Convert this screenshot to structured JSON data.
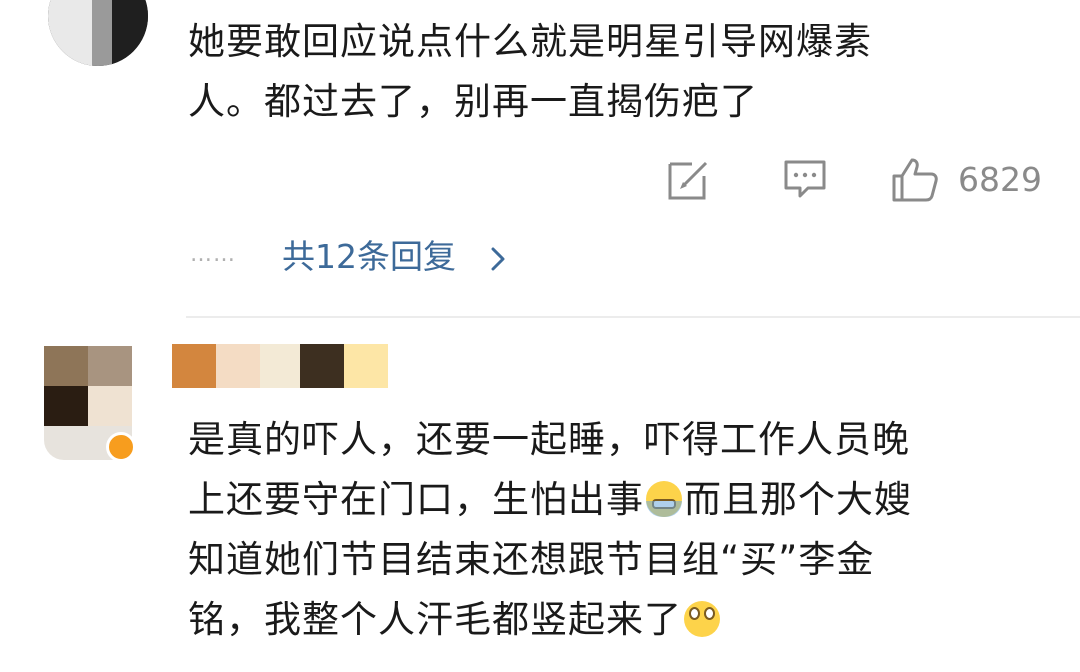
{
  "comments": [
    {
      "text": "她要敢回应说点什么就是明星引导网爆素\n人。都过去了，别再一直揭伤疤了",
      "like_count": "6829",
      "replies_label": "共12条回复",
      "ellipsis": "……"
    },
    {
      "segments": [
        "是真的吓人，还要一起睡，吓得工作人员晚\n上还要守在门口，生怕出事",
        "而且那个大嫂\n知道她们节目结束还想跟节目组“买”李金\n铭，我整个人汗毛都竖起来了"
      ],
      "emojis": [
        "scared-emoji",
        "eye-roll-emoji"
      ]
    }
  ],
  "icons": [
    "edit-icon",
    "comment-icon",
    "like-icon",
    "chevron-right-icon",
    "verified-badge-icon"
  ],
  "colors": {
    "link": "#3d6a99",
    "muted": "#8a8a8a",
    "badge": "#f79d1e",
    "divider": "#ececec"
  }
}
